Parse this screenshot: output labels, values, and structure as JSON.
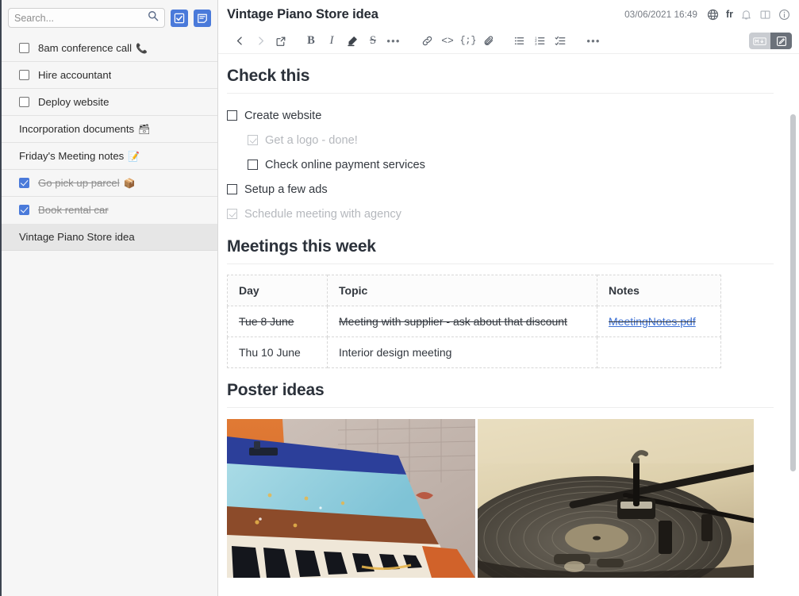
{
  "sidebar": {
    "search": {
      "placeholder": "Search...",
      "value": ""
    },
    "buttons": [
      {
        "name": "new-todo-button",
        "icon": "checkbox-icon"
      },
      {
        "name": "new-note-button",
        "icon": "note-icon"
      }
    ],
    "items": [
      {
        "label": "8am conference call",
        "emoji": "📞",
        "checkbox": true,
        "checked": false,
        "done": false,
        "selected": false
      },
      {
        "label": "Hire accountant",
        "emoji": "",
        "checkbox": true,
        "checked": false,
        "done": false,
        "selected": false
      },
      {
        "label": "Deploy website",
        "emoji": "",
        "checkbox": true,
        "checked": false,
        "done": false,
        "selected": false
      },
      {
        "label": "Incorporation documents",
        "emoji": "🗃",
        "checkbox": false,
        "checked": false,
        "done": false,
        "selected": false
      },
      {
        "label": "Friday's Meeting notes",
        "emoji": "📝",
        "checkbox": false,
        "checked": false,
        "done": false,
        "selected": false
      },
      {
        "label": "Go pick up parcel",
        "emoji": "📦",
        "checkbox": true,
        "checked": true,
        "done": true,
        "selected": false
      },
      {
        "label": "Book rental car",
        "emoji": "",
        "checkbox": true,
        "checked": true,
        "done": true,
        "selected": false
      },
      {
        "label": "Vintage Piano Store idea",
        "emoji": "",
        "checkbox": false,
        "checked": false,
        "done": false,
        "selected": true
      }
    ]
  },
  "header": {
    "title": "Vintage Piano Store idea",
    "date": "03/06/2021 16:49",
    "language": "fr",
    "icons": [
      "globe-icon",
      "bell-icon",
      "split-view-icon",
      "info-icon"
    ]
  },
  "toolbar": {
    "back": "back-arrow-icon",
    "forward": "forward-arrow-icon",
    "external": "external-link-icon",
    "bold": "B",
    "italic": "I",
    "highlight": "highlighter-icon",
    "strikethrough": "S",
    "more1": "•••",
    "link": "link-icon",
    "code": "<>",
    "snippet": "{;}",
    "attach": "paperclip-icon",
    "bullet_list": "bulleted-list-icon",
    "numbered_list": "numbered-list-icon",
    "check_list": "checklist-icon",
    "more2": "•••",
    "markdown_label": "MD",
    "edit_label": "edit-pencil-icon"
  },
  "content": {
    "sections": [
      {
        "heading": "Check this"
      },
      {
        "heading": "Meetings this week"
      },
      {
        "heading": "Poster ideas"
      }
    ],
    "tasks": [
      {
        "label": "Create website",
        "indent": false,
        "done": false
      },
      {
        "label": "Get a logo - done!",
        "indent": true,
        "done": true
      },
      {
        "label": "Check online payment services",
        "indent": true,
        "done": false
      },
      {
        "label": "Setup a few ads",
        "indent": false,
        "done": false
      },
      {
        "label": "Schedule meeting with agency",
        "indent": false,
        "done": true
      }
    ],
    "table": {
      "columns": [
        "Day",
        "Topic",
        "Notes"
      ],
      "rows": [
        {
          "struck": true,
          "cells": [
            "Tue 8 June",
            "Meeting with supplier - ask about that discount",
            "MeetingNotes.pdf"
          ],
          "link_index": 2
        },
        {
          "struck": false,
          "cells": [
            "Thu 10 June",
            "Interior design meeting",
            ""
          ],
          "link_index": -1
        }
      ]
    },
    "images": [
      {
        "name": "piano-photo",
        "alt": "Colorful vintage piano keyboard"
      },
      {
        "name": "turntable-photo",
        "alt": "Sepia record player turntable"
      }
    ]
  },
  "colors": {
    "accent": "#4a7ada",
    "link": "#3b6fd4",
    "sidebar_bg": "#f6f6f6",
    "selected_bg": "#e6e6e6",
    "text": "#2b313a",
    "muted": "#8e8e8e"
  }
}
